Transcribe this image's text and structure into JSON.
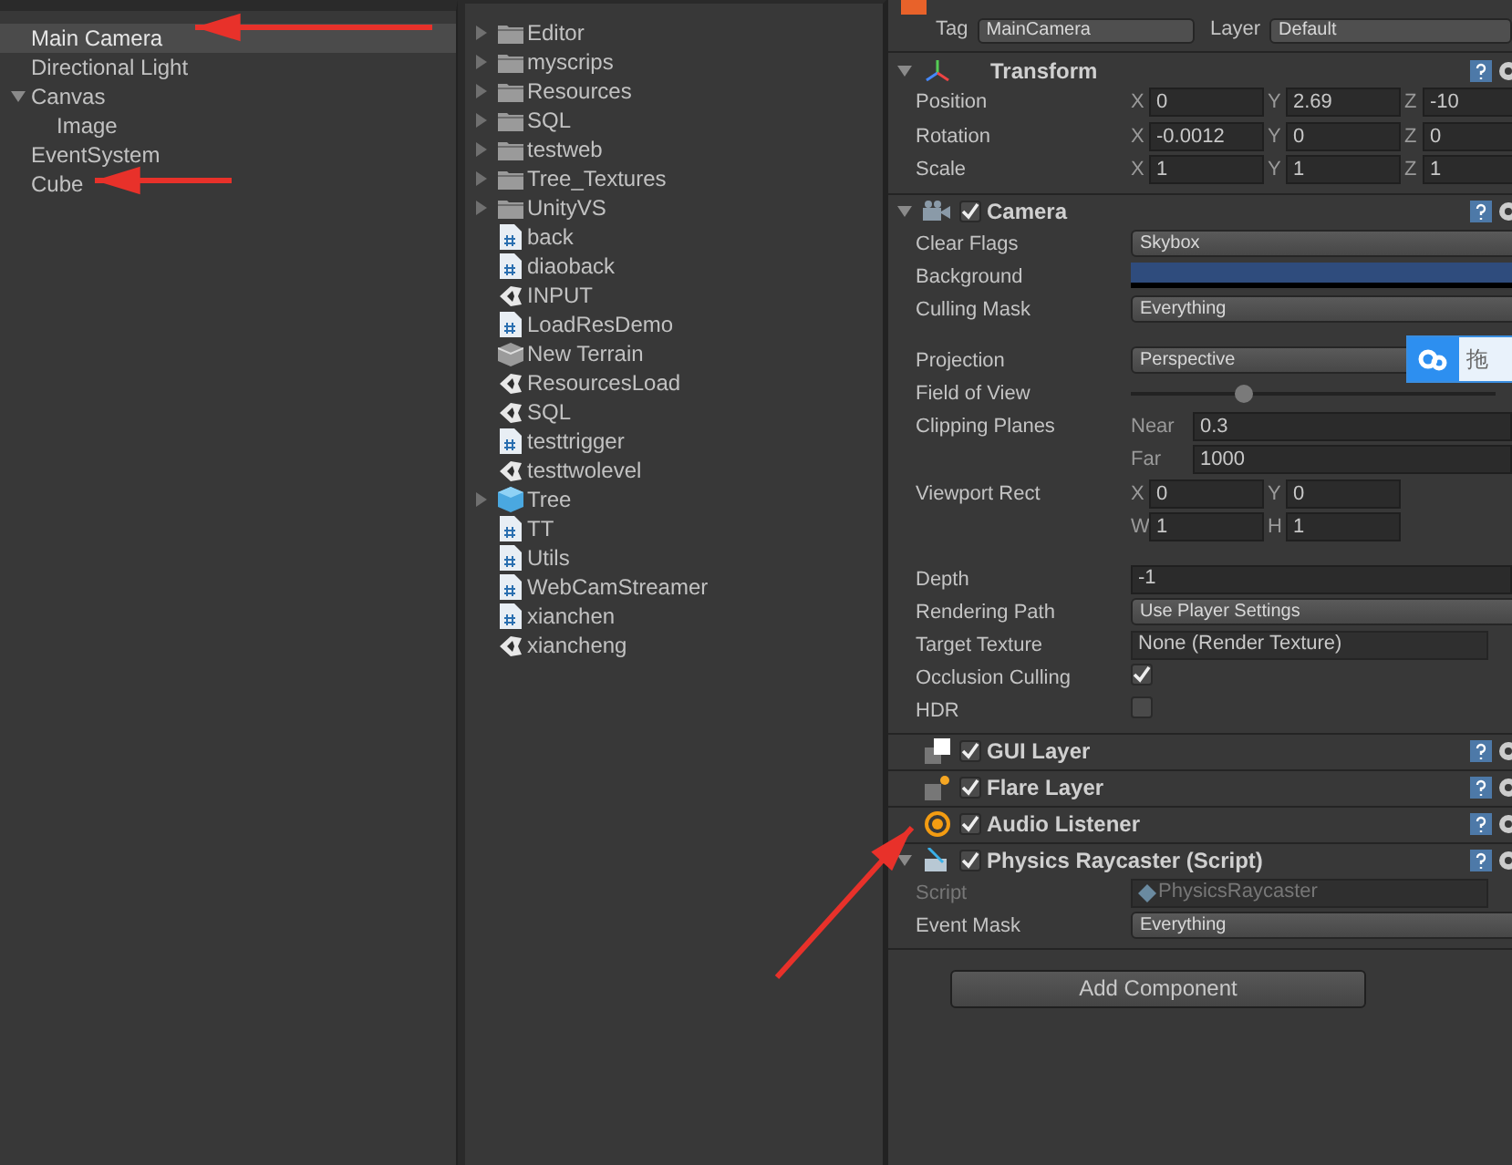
{
  "hierarchy": {
    "items": [
      {
        "label": "Main Camera",
        "selected": true
      },
      {
        "label": "Directional Light",
        "selected": false
      },
      {
        "label": "Canvas",
        "selected": false,
        "expanded": true,
        "children": [
          {
            "label": "Image",
            "selected": false
          }
        ]
      },
      {
        "label": "EventSystem",
        "selected": false
      },
      {
        "label": "Cube",
        "selected": false
      }
    ]
  },
  "project": {
    "items": [
      {
        "label": "Editor",
        "kind": "folder"
      },
      {
        "label": "myscrips",
        "kind": "folder"
      },
      {
        "label": "Resources",
        "kind": "folder"
      },
      {
        "label": "SQL",
        "kind": "folder"
      },
      {
        "label": "testweb",
        "kind": "folder"
      },
      {
        "label": "Tree_Textures",
        "kind": "folder"
      },
      {
        "label": "UnityVS",
        "kind": "folder"
      },
      {
        "label": "back",
        "kind": "script"
      },
      {
        "label": "diaoback",
        "kind": "script"
      },
      {
        "label": "INPUT",
        "kind": "scene"
      },
      {
        "label": "LoadResDemo",
        "kind": "script"
      },
      {
        "label": "New Terrain",
        "kind": "terrain"
      },
      {
        "label": "ResourcesLoad",
        "kind": "scene"
      },
      {
        "label": "SQL",
        "kind": "scene"
      },
      {
        "label": "testtrigger",
        "kind": "script"
      },
      {
        "label": "testtwolevel",
        "kind": "scene"
      },
      {
        "label": "Tree",
        "kind": "prefab"
      },
      {
        "label": "TT",
        "kind": "script"
      },
      {
        "label": "Utils",
        "kind": "script"
      },
      {
        "label": "WebCamStreamer",
        "kind": "script"
      },
      {
        "label": "xianchen",
        "kind": "script"
      },
      {
        "label": "xiancheng",
        "kind": "scene"
      }
    ]
  },
  "inspector": {
    "tag": {
      "label": "Tag",
      "value": "MainCamera"
    },
    "layer": {
      "label": "Layer",
      "value": "Default"
    },
    "components": [
      {
        "title": "Transform",
        "kind": "transform",
        "expanded": true,
        "fields": [
          {
            "label": "Position",
            "kind": "xyz",
            "parts": [
              {
                "axis": "X",
                "value": "0"
              },
              {
                "axis": "Y",
                "value": "2.69"
              },
              {
                "axis": "Z",
                "value": "-10"
              }
            ]
          },
          {
            "label": "Rotation",
            "kind": "xyz",
            "parts": [
              {
                "axis": "X",
                "value": "-0.0012"
              },
              {
                "axis": "Y",
                "value": "0"
              },
              {
                "axis": "Z",
                "value": "0"
              }
            ]
          },
          {
            "label": "Scale",
            "kind": "xyz",
            "parts": [
              {
                "axis": "X",
                "value": "1"
              },
              {
                "axis": "Y",
                "value": "1"
              },
              {
                "axis": "Z",
                "value": "1"
              }
            ]
          }
        ]
      },
      {
        "title": "Camera",
        "kind": "camera",
        "enabled": true,
        "expanded": true,
        "fields": [
          {
            "label": "Clear Flags",
            "kind": "dropdown",
            "value": "Skybox"
          },
          {
            "label": "Background",
            "kind": "color",
            "color": "#2f4c7d"
          },
          {
            "label": "Culling Mask",
            "kind": "dropdown",
            "value": "Everything"
          },
          {
            "kind": "spacer"
          },
          {
            "label": "Projection",
            "kind": "dropdown",
            "value": "Perspective"
          },
          {
            "label": "Field of View",
            "kind": "slider",
            "level": 0.3
          },
          {
            "label": "Clipping Planes",
            "kind": "pairs",
            "rows": [
              [
                {
                  "axis": "Near",
                  "value": "0.3"
                }
              ],
              [
                {
                  "axis": "Far",
                  "value": "1000"
                }
              ]
            ]
          },
          {
            "label": "Viewport Rect",
            "kind": "pairs",
            "rows": [
              [
                {
                  "axis": "X",
                  "value": "0"
                },
                {
                  "axis": "Y",
                  "value": "0"
                }
              ],
              [
                {
                  "axis": "W",
                  "value": "1"
                },
                {
                  "axis": "H",
                  "value": "1"
                }
              ]
            ]
          },
          {
            "kind": "spacer"
          },
          {
            "label": "Depth",
            "kind": "text",
            "value": "-1"
          },
          {
            "label": "Rendering Path",
            "kind": "dropdown",
            "value": "Use Player Settings"
          },
          {
            "label": "Target Texture",
            "kind": "object",
            "value": "None (Render Texture)"
          },
          {
            "label": "Occlusion Culling",
            "kind": "checkbox",
            "checked": true
          },
          {
            "label": "HDR",
            "kind": "checkbox",
            "checked": false
          }
        ]
      },
      {
        "title": "GUI Layer",
        "kind": "gui_layer",
        "enabled": true
      },
      {
        "title": "Flare Layer",
        "kind": "flare_layer",
        "enabled": true
      },
      {
        "title": "Audio Listener",
        "kind": "audio_listener",
        "enabled": true
      },
      {
        "title": "Physics Raycaster (Script)",
        "kind": "script",
        "enabled": true,
        "expanded": true,
        "fields": [
          {
            "label": "Script",
            "kind": "object",
            "value": "PhysicsRaycaster",
            "disabled": true
          },
          {
            "label": "Event Mask",
            "kind": "dropdown",
            "value": "Everything"
          }
        ]
      }
    ],
    "add_button": "Add Component"
  },
  "floating_widget": {
    "label": "拖"
  }
}
